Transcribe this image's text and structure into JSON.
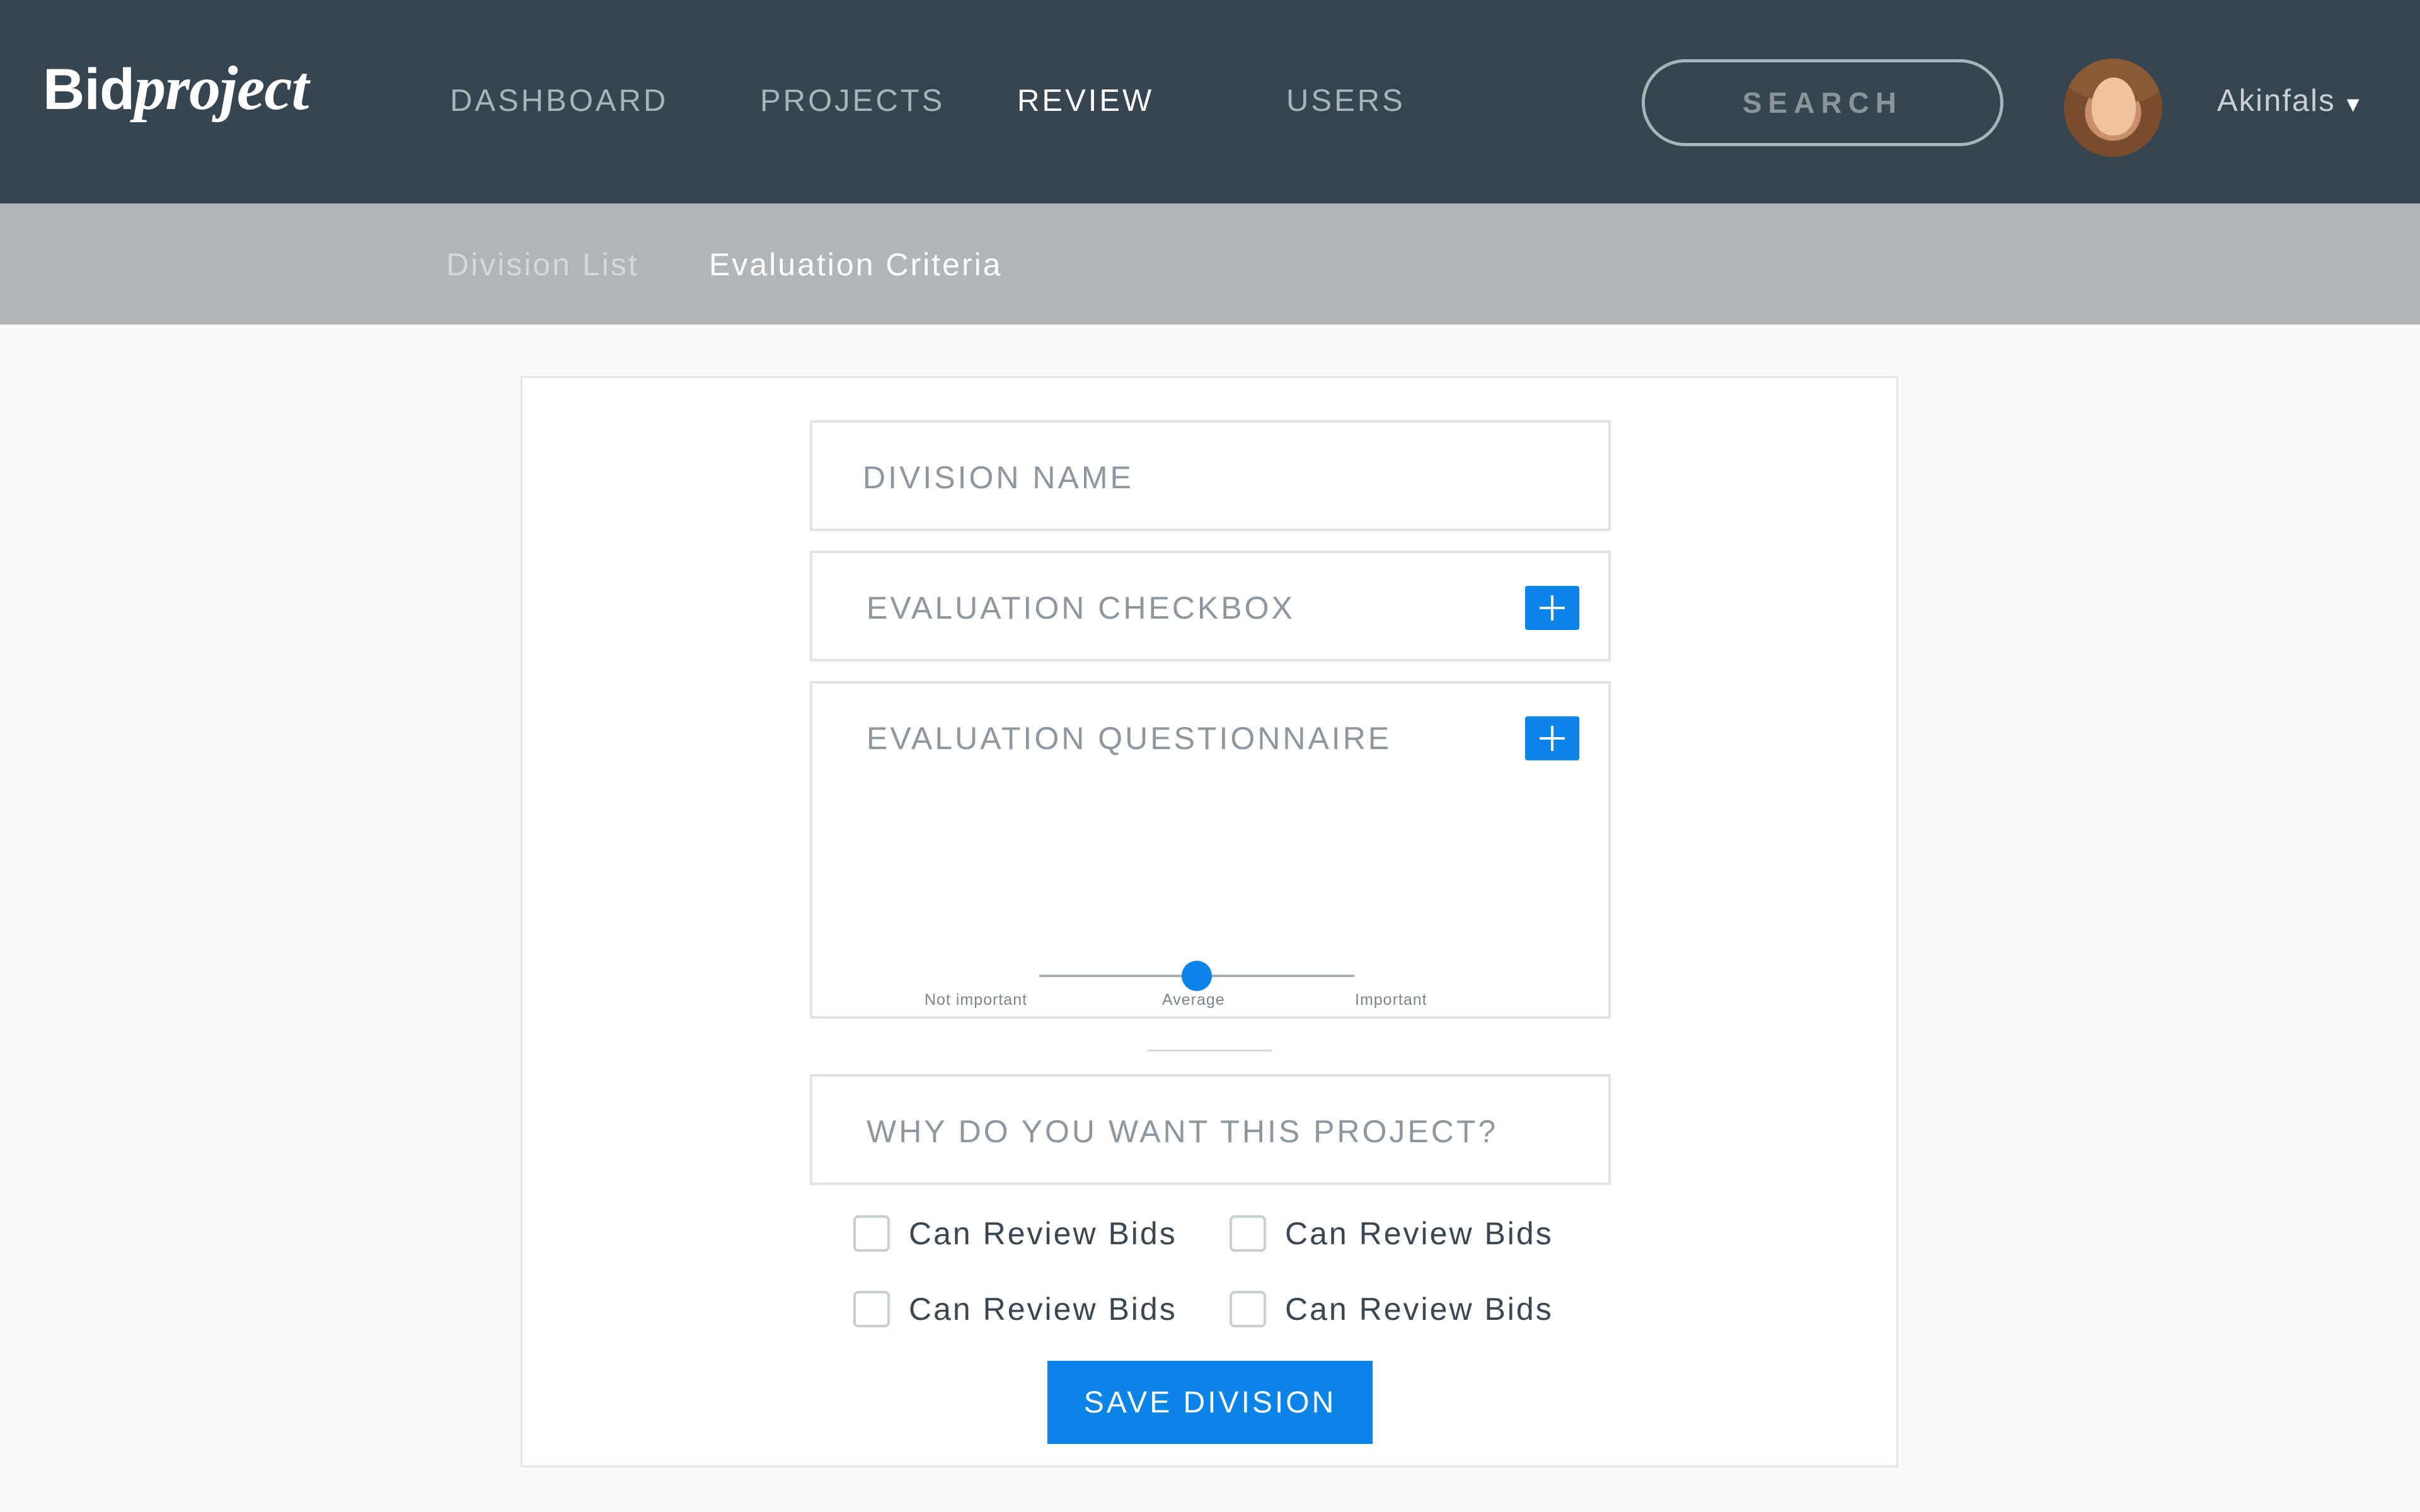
{
  "brand": {
    "bid": "Bid",
    "project": "project"
  },
  "nav": {
    "items": [
      {
        "label": "DASHBOARD",
        "active": false
      },
      {
        "label": "PROJECTS",
        "active": false
      },
      {
        "label": "REVIEW",
        "active": true
      },
      {
        "label": "USERS",
        "active": false
      }
    ]
  },
  "search": {
    "label": "SEARCH"
  },
  "user": {
    "name": "Akinfals",
    "caret": "▾"
  },
  "subnav": {
    "items": [
      {
        "label": "Division List",
        "active": false
      },
      {
        "label": "Evaluation Criteria",
        "active": true
      }
    ]
  },
  "form": {
    "division_name_placeholder": "DIVISION NAME",
    "evaluation_checkbox_label": "EVALUATION CHECKBOX",
    "evaluation_questionnaire_label": "EVALUATION QUESTIONNAIRE",
    "importance_slider": {
      "labels": [
        "Not important",
        "Average",
        "Important"
      ],
      "value": 0.5
    },
    "why_placeholder": "WHY DO YOU WANT THIS PROJECT?",
    "permissions": [
      {
        "label": "Can Review Bids",
        "checked": false
      },
      {
        "label": "Can Review Bids",
        "checked": false
      },
      {
        "label": "Can Review Bids",
        "checked": false
      },
      {
        "label": "Can Review Bids",
        "checked": false
      }
    ],
    "save_label": "SAVE DIVISION"
  },
  "colors": {
    "topbar": "#36454f",
    "subbar": "#b0b5b9",
    "accent": "#0a84e6"
  }
}
